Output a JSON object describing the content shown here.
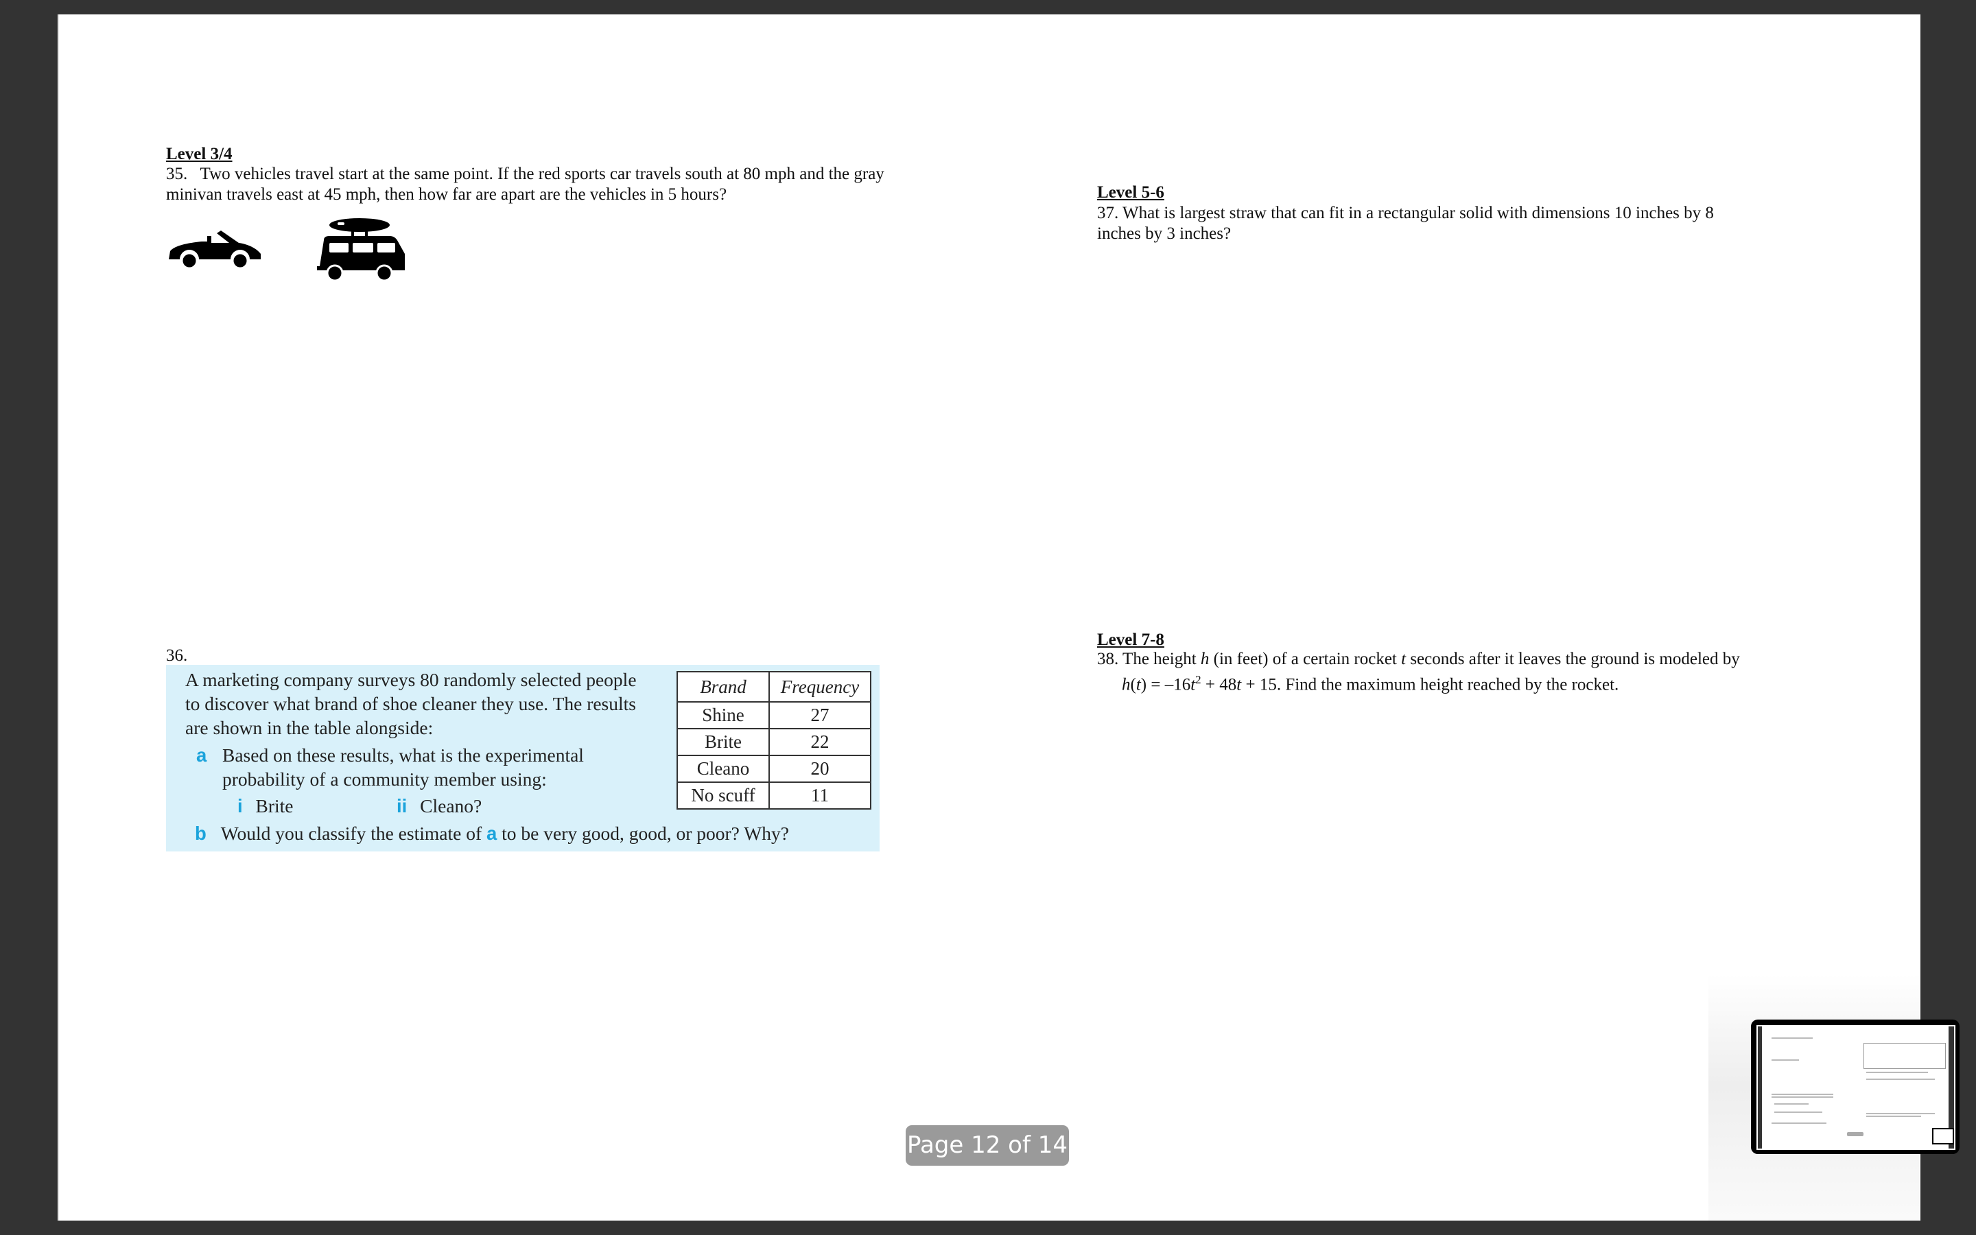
{
  "viewer": {
    "page_indicator": "Page 12 of 14",
    "current_page": 12,
    "total_pages": 14
  },
  "left_column": {
    "q35": {
      "level": "Level 3/4",
      "line1": "35.   Two vehicles travel start at the same point. If the red sports car travels south at 80 mph and the gray",
      "line2": "minivan travels east at 45 mph, then how far are apart are the vehicles in 5 hours?",
      "icons": [
        "convertible-car-icon",
        "minivan-with-surfboard-icon"
      ]
    },
    "q36": {
      "number": "36.",
      "intro": [
        "A marketing company surveys 80 randomly selected people",
        "to discover what brand of shoe cleaner they use.  The results",
        "are shown in the table alongside:"
      ],
      "part_a_label": "a",
      "part_a": [
        "Based on these results, what is the experimental",
        "probability of a community member using:"
      ],
      "sub_i_label": "i",
      "sub_i": "Brite",
      "sub_ii_label": "ii",
      "sub_ii": "Cleano?",
      "part_b_label": "b",
      "part_b_pre": "Would you classify the estimate of",
      "part_b_ref": "a",
      "part_b_post": "to be very good, good, or poor?  Why?",
      "table": {
        "headers": [
          "Brand",
          "Frequency"
        ],
        "rows": [
          [
            "Shine",
            "27"
          ],
          [
            "Brite",
            "22"
          ],
          [
            "Cleano",
            "20"
          ],
          [
            "No scuff",
            "11"
          ]
        ]
      }
    }
  },
  "right_column": {
    "q37": {
      "level": "Level 5-6",
      "line1": "37.  What is largest straw that can fit in a rectangular solid with dimensions 10 inches by 8",
      "line2": "inches by 3 inches?"
    },
    "q38": {
      "level": "Level 7-8",
      "line1_pre": "38. The height ",
      "line1_h": "h",
      "line1_mid": " (in feet) of a certain rocket ",
      "line1_t": "t",
      "line1_post": " seconds after it leaves the ground is modeled by",
      "line2_func": "h",
      "line2_paren_open": "(",
      "line2_var": "t",
      "line2_eq": ") = –16",
      "line2_t1": "t",
      "line2_sq": "2",
      "line2_mid": " + 48",
      "line2_t2": "t",
      "line2_post": " + 15. Find the maximum height reached by the rocket."
    }
  },
  "colors": {
    "background": "#333333",
    "page": "#ffffff",
    "question_box": "#d9f1fa",
    "accent_blue": "#1ba3db",
    "badge": "#9a9a9a"
  }
}
